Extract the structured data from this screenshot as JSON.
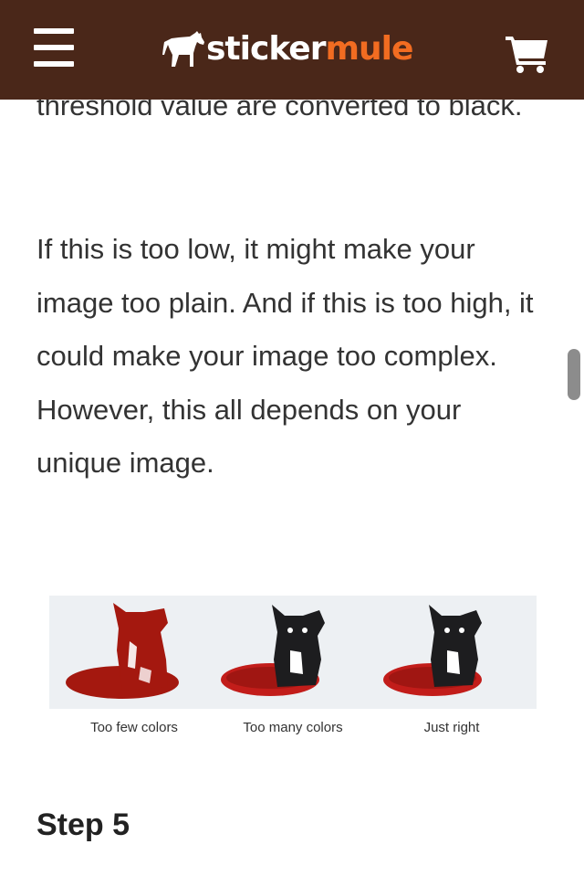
{
  "header": {
    "menu_icon": "hamburger-menu-icon",
    "logo_part1": "sticker",
    "logo_part2": "mule",
    "cart_icon": "shopping-cart-icon",
    "colors": {
      "background": "#4a2719",
      "brand_orange": "#f26c21"
    }
  },
  "article": {
    "para1": "threshold value are converted to black.",
    "para2": "If this is too low, it might make your image too plain. And if this is too high, it could make your image too complex. However, this all depends on your unique image.",
    "figure": {
      "captions": [
        "Too few colors",
        "Too many colors",
        "Just right"
      ]
    },
    "step_heading": "Step 5"
  }
}
